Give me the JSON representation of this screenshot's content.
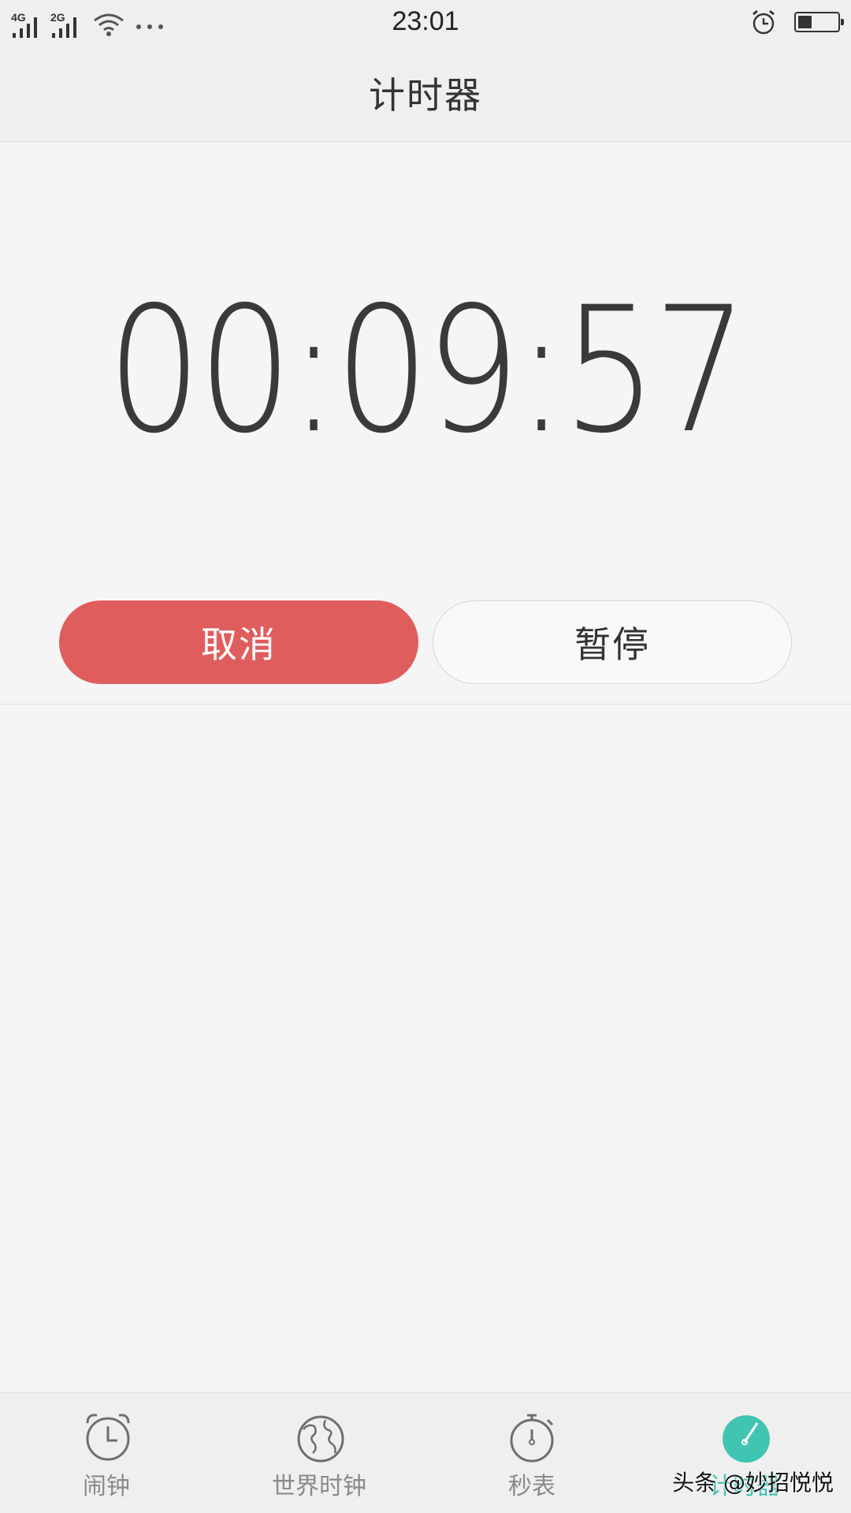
{
  "status_bar": {
    "network_1": "4G",
    "network_2": "2G",
    "time": "23:01",
    "battery_level": 0.35,
    "icons": [
      "signal-icon",
      "wifi-icon",
      "more-dots-icon",
      "alarm-icon",
      "battery-icon"
    ]
  },
  "header": {
    "title": "计时器"
  },
  "timer": {
    "display": "00:09:57",
    "cancel_label": "取消",
    "pause_label": "暂停"
  },
  "bottom_nav": {
    "tabs": [
      {
        "label": "闹钟",
        "icon": "alarm-clock-icon",
        "active": false
      },
      {
        "label": "世界时钟",
        "icon": "globe-icon",
        "active": false
      },
      {
        "label": "秒表",
        "icon": "stopwatch-icon",
        "active": false
      },
      {
        "label": "计时器",
        "icon": "timer-icon",
        "active": true
      }
    ]
  },
  "watermark": "头条 @妙招悦悦",
  "colors": {
    "accent": "#3fc5b2",
    "cancel": "#e05d5d",
    "background": "#f5f5f5",
    "bar": "#efefef"
  }
}
